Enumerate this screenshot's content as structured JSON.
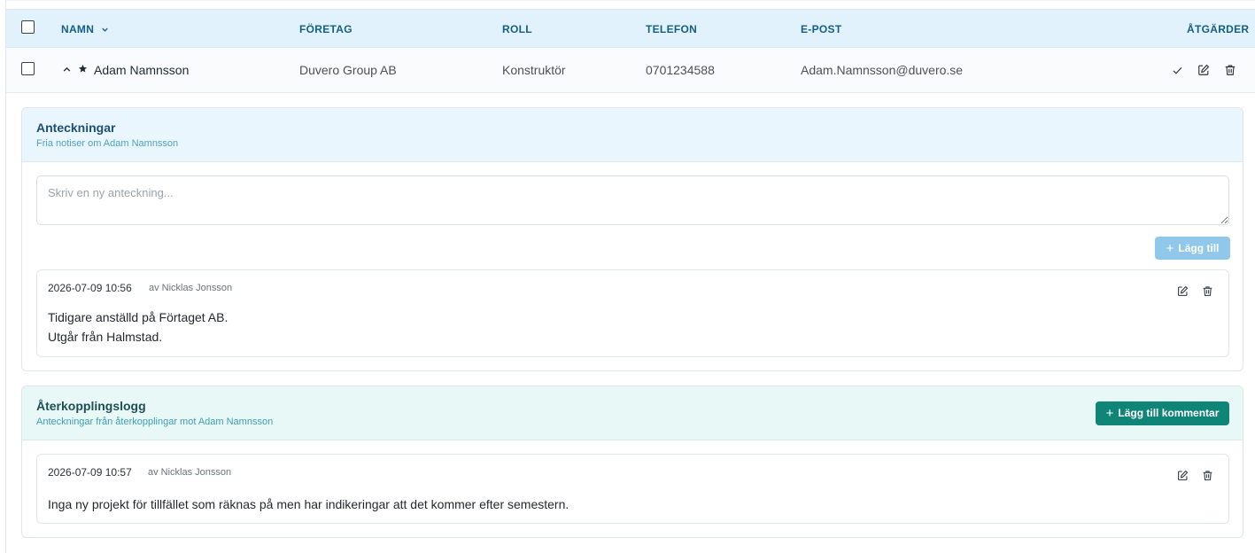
{
  "table": {
    "columns": {
      "name": "NAMN",
      "company": "FÖRETAG",
      "role": "ROLL",
      "phone": "TELEFON",
      "email": "E-POST",
      "actions": "ÅTGÄRDER"
    },
    "sort_icon": "chevron-down-icon",
    "row": {
      "name": "Adam Namnsson",
      "company": "Duvero Group AB",
      "role": "Konstruktör",
      "phone": "0701234588",
      "email": "Adam.Namnsson@duvero.se",
      "starred": true,
      "expanded": true,
      "action_icons": [
        "check-icon",
        "edit-icon",
        "trash-icon"
      ]
    }
  },
  "notes": {
    "title": "Anteckningar",
    "subtitle": "Fria notiser om Adam Namnsson",
    "input_placeholder": "Skriv en ny anteckning...",
    "add_label": "Lägg till",
    "entries": [
      {
        "date": "2026-07-09 10:56",
        "author": "av Nicklas Jonsson",
        "lines": [
          "Tidigare anställd på Förtaget AB.",
          "Utgår från Halmstad."
        ]
      }
    ]
  },
  "feedback": {
    "title": "Återkopplingslogg",
    "subtitle": "Anteckningar från återkopplingar mot Adam Namnsson",
    "add_comment_label": "Lägg till kommentar",
    "entries": [
      {
        "date": "2026-07-09 10:57",
        "author": "av Nicklas Jonsson",
        "text": "Inga ny projekt för tillfället som räknas på men har indikeringar att det kommer efter semestern."
      }
    ]
  },
  "colors": {
    "header_bg": "#e1f2fc",
    "header_text": "#145f86",
    "primary_teal": "#0f8577",
    "add_button_disabled": "#8fc8ea"
  }
}
